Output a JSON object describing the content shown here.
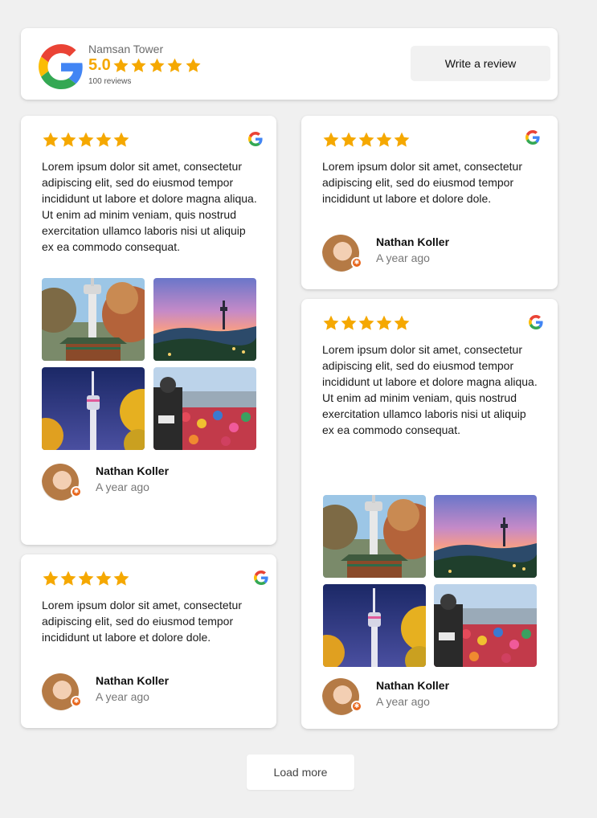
{
  "header": {
    "place_name": "Namsan Tower",
    "rating": "5.0",
    "star_count": 5,
    "reviews_count": "100 reviews",
    "write_review_label": "Write a review"
  },
  "colors": {
    "star": "#f5a800",
    "badge": "#e8661b",
    "google_blue": "#4285F4",
    "google_red": "#EA4335",
    "google_yellow": "#FBBC05",
    "google_green": "#34A853"
  },
  "reviews": [
    {
      "rating": 5,
      "text": "Lorem ipsum dolor sit amet, consectetur adipiscing elit, sed do eiusmod tempor incididunt ut labore et dolore magna aliqua. Ut enim ad minim veniam, quis nostrud exercitation ullamco laboris nisi ut aliquip ex ea commodo consequat.",
      "author": "Nathan Koller",
      "time": "A year ago",
      "photos": [
        "tower-autumn-photo",
        "tower-sunset-photo",
        "tower-night-photo",
        "love-locks-photo"
      ]
    },
    {
      "rating": 5,
      "text": "Lorem ipsum dolor sit amet, consectetur adipiscing elit, sed do eiusmod tempor incididunt ut labore et dolore dole.",
      "author": "Nathan Koller",
      "time": "A year ago",
      "photos": []
    },
    {
      "rating": 5,
      "text": "Lorem ipsum dolor sit amet, consectetur adipiscing elit, sed do eiusmod tempor incididunt ut labore et dolore magna aliqua. Ut enim ad minim veniam, quis nostrud exercitation ullamco laboris nisi ut aliquip ex ea commodo consequat.",
      "author": "Nathan Koller",
      "time": "A year ago",
      "photos": [
        "tower-autumn-photo",
        "tower-sunset-photo",
        "tower-night-photo",
        "love-locks-photo"
      ]
    },
    {
      "rating": 5,
      "text": "Lorem ipsum dolor sit amet, consectetur adipiscing elit, sed do eiusmod tempor incididunt ut labore et dolore dole.",
      "author": "Nathan Koller",
      "time": "A year ago",
      "photos": []
    }
  ],
  "load_more_label": "Load more"
}
